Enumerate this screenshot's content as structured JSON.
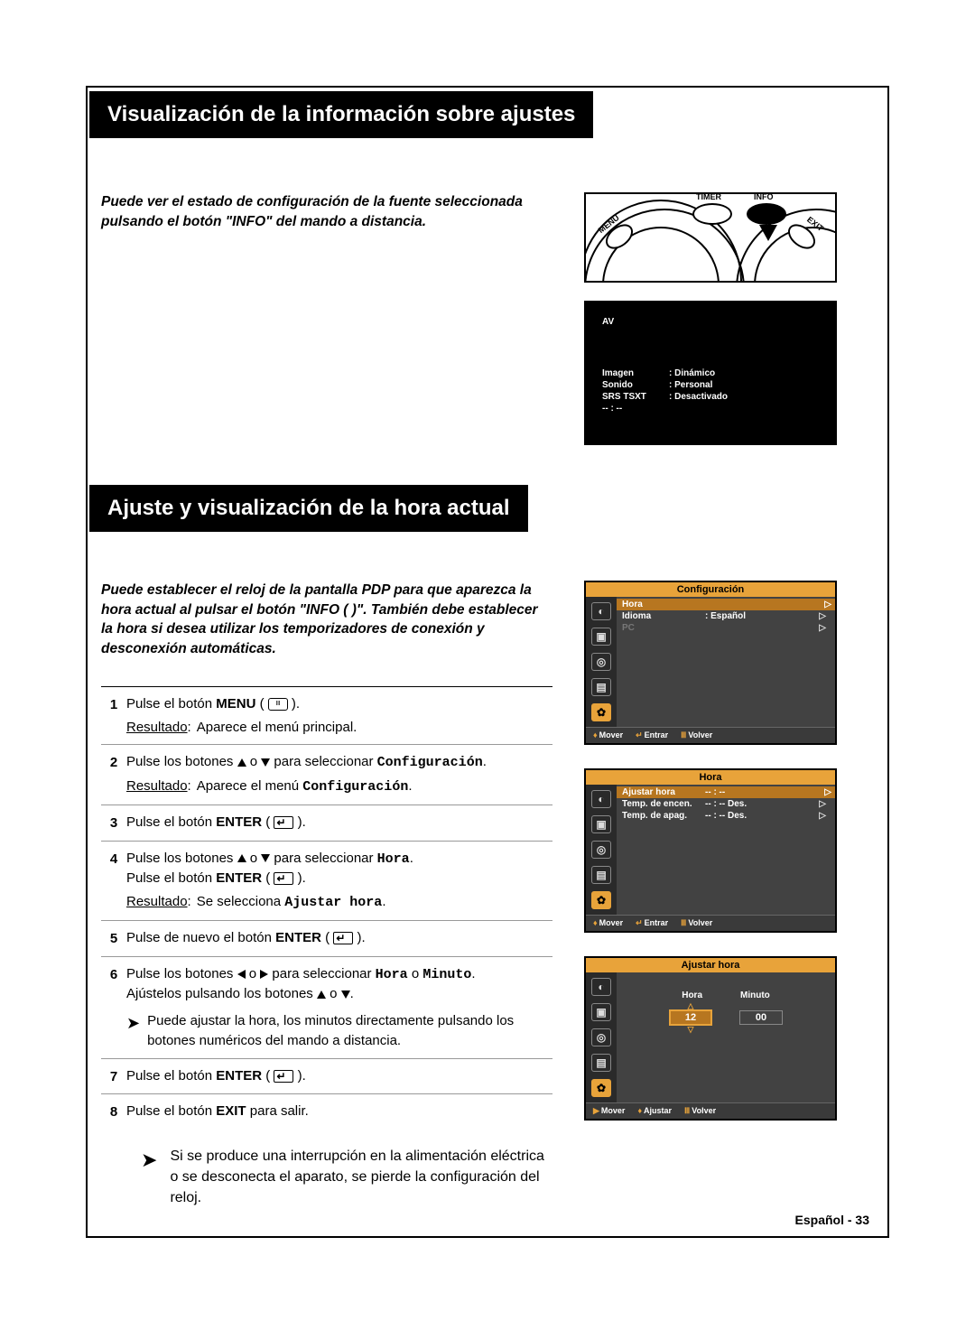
{
  "title1": "Visualización de la información sobre ajustes",
  "intro1": "Puede ver el estado de configuración de la fuente seleccionada pulsando el botón \"INFO\" del mando a distancia.",
  "remote": {
    "timer": "TIMER",
    "info": "INFO",
    "menu": "MENU",
    "exit": "EXIT"
  },
  "info_screen": {
    "source": "AV",
    "rows": [
      {
        "k": "Imagen",
        "v": ": Dinámico"
      },
      {
        "k": "Sonido",
        "v": ": Personal"
      },
      {
        "k": "SRS TSXT",
        "v": ": Desactivado"
      },
      {
        "k": "-- : --",
        "v": ""
      }
    ]
  },
  "title2": "Ajuste y visualización de la hora actual",
  "intro2": "Puede establecer el reloj de la pantalla PDP para que aparezca la hora actual al pulsar el botón \"INFO (        )\". También debe establecer la hora si desea utilizar los temporizadores de conexión y desconexión automáticas.",
  "steps": [
    {
      "n": "1",
      "lines": [
        {
          "t": "Pulse el botón ",
          "b": "MENU",
          "post": " ( ",
          "icon": "roman",
          "post2": " )."
        }
      ],
      "result": {
        "label": "Resultado",
        "text": "Aparece el menú principal."
      }
    },
    {
      "n": "2",
      "lines": [
        {
          "t": "Pulse los botones ",
          "arrows": "ud",
          "post": " para seleccionar ",
          "mono": "Configuración",
          "post2": "."
        }
      ],
      "result": {
        "label": "Resultado",
        "text": "Aparece el menú ",
        "mono": "Configuración",
        "post": "."
      }
    },
    {
      "n": "3",
      "lines": [
        {
          "t": "Pulse el botón ",
          "b": "ENTER",
          "post": " ( ",
          "icon": "enter",
          "post2": " )."
        }
      ]
    },
    {
      "n": "4",
      "lines": [
        {
          "t": "Pulse los botones ",
          "arrows": "ud",
          "post": " para seleccionar ",
          "mono": "Hora",
          "post2": "."
        },
        {
          "t": "Pulse el botón ",
          "b": "ENTER",
          "post": " ( ",
          "icon": "enter",
          "post2": " )."
        }
      ],
      "result": {
        "label": "Resultado",
        "text": "Se selecciona ",
        "mono": "Ajustar hora",
        "post": "."
      }
    },
    {
      "n": "5",
      "lines": [
        {
          "t": "Pulse de nuevo el botón ",
          "b": "ENTER",
          "post": " ( ",
          "icon": "enter",
          "post2": " )."
        }
      ]
    },
    {
      "n": "6",
      "lines": [
        {
          "t": "Pulse los botones ",
          "arrows": "lr",
          "post": " para seleccionar ",
          "mono": "Hora",
          "mid": " o ",
          "mono2": "Minuto",
          "post2": "."
        },
        {
          "t": "Ajústelos pulsando los botones ",
          "arrows": "ud",
          "post2": "."
        }
      ],
      "note": "Puede ajustar la hora, los minutos directamente pulsando los botones numéricos del mando a distancia."
    },
    {
      "n": "7",
      "lines": [
        {
          "t": "Pulse el botón ",
          "b": "ENTER",
          "post": " ( ",
          "icon": "enter",
          "post2": " )."
        }
      ]
    },
    {
      "n": "8",
      "lines": [
        {
          "t": "Pulse el botón ",
          "b": "EXIT",
          "post2": " para salir."
        }
      ]
    }
  ],
  "final_note": "Si se produce una interrupción en la alimentación eléctrica o se desconecta el aparato, se pierde la configuración del reloj.",
  "osd_config": {
    "title": "Configuración",
    "rows": [
      {
        "l": "Hora",
        "v": "",
        "hl": true,
        "tri": true
      },
      {
        "l": "Idioma",
        "v": ": Español",
        "tri": true
      },
      {
        "l": "PC",
        "v": "",
        "dim": true,
        "tri": true
      }
    ],
    "foot": {
      "a": "Mover",
      "b": "Entrar",
      "c": "Volver"
    }
  },
  "osd_hora": {
    "title": "Hora",
    "rows": [
      {
        "l": "Ajustar hora",
        "v": "-- : --",
        "hl": true,
        "tri": true
      },
      {
        "l": "Temp. de encen.",
        "v": "-- : --   Des.",
        "tri": true
      },
      {
        "l": "Temp. de apag.",
        "v": "-- : --   Des.",
        "tri": true
      }
    ],
    "foot": {
      "a": "Mover",
      "b": "Entrar",
      "c": "Volver"
    }
  },
  "osd_adjust": {
    "title": "Ajustar hora",
    "labels": {
      "h": "Hora",
      "m": "Minuto"
    },
    "values": {
      "h": "12",
      "m": "00"
    },
    "foot": {
      "a": "Mover",
      "b": "Ajustar",
      "c": "Volver"
    }
  },
  "footer": "Español - 33"
}
